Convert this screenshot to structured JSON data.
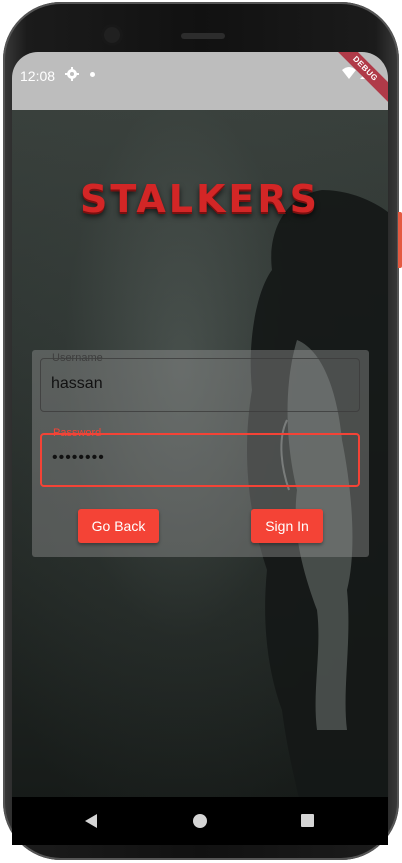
{
  "status_bar": {
    "time": "12:08",
    "debug_label": "DEBUG"
  },
  "app": {
    "logo_text": "STALKERS"
  },
  "form": {
    "username": {
      "label": "Username",
      "value": "hassan"
    },
    "password": {
      "label": "Password",
      "value": "••••••••"
    },
    "buttons": {
      "go_back": "Go Back",
      "sign_in": "Sign In"
    }
  },
  "colors": {
    "accent": "#f44336",
    "logo": "#d32626",
    "status_bar_bg": "#bdbdbd",
    "nav_bar_bg": "#000000"
  },
  "icons": {
    "status_left": "settings-gear-icon",
    "status_right": [
      "wifi-icon",
      "signal-icon"
    ],
    "nav": [
      "back-triangle-icon",
      "home-circle-icon",
      "recents-square-icon"
    ]
  }
}
